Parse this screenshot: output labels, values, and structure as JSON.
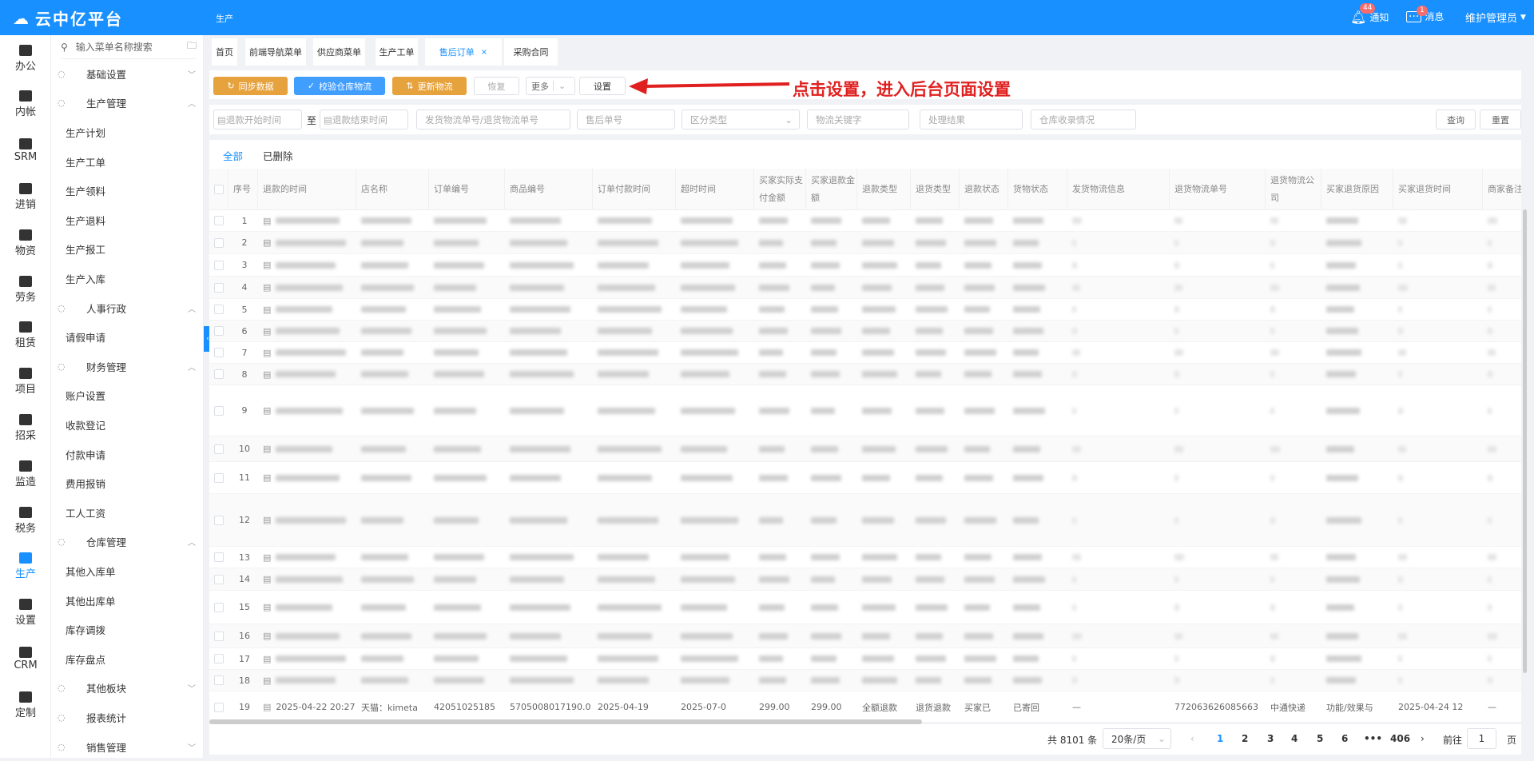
{
  "header": {
    "logo": "云中亿平台",
    "breadcrumb": "生产",
    "notify_label": "通知",
    "notify_count": "44",
    "message_label": "消息",
    "message_count": "1",
    "user": "维护管理员"
  },
  "rail": [
    {
      "label": "办公"
    },
    {
      "label": "内帐"
    },
    {
      "label": "SRM"
    },
    {
      "label": "进销"
    },
    {
      "label": "物资"
    },
    {
      "label": "劳务"
    },
    {
      "label": "租赁"
    },
    {
      "label": "项目"
    },
    {
      "label": "招采"
    },
    {
      "label": "监造"
    },
    {
      "label": "税务"
    },
    {
      "label": "生产",
      "active": true
    },
    {
      "label": "设置"
    },
    {
      "label": "CRM"
    },
    {
      "label": "定制"
    }
  ],
  "sidebar": {
    "search_placeholder": "输入菜单名称搜索",
    "items": [
      {
        "label": "基础设置",
        "type": "group",
        "expanded": false
      },
      {
        "label": "生产管理",
        "type": "group",
        "expanded": true
      },
      {
        "label": "生产计划",
        "type": "sub"
      },
      {
        "label": "生产工单",
        "type": "sub"
      },
      {
        "label": "生产领料",
        "type": "sub"
      },
      {
        "label": "生产退料",
        "type": "sub"
      },
      {
        "label": "生产报工",
        "type": "sub"
      },
      {
        "label": "生产入库",
        "type": "sub"
      },
      {
        "label": "人事行政",
        "type": "group",
        "expanded": true
      },
      {
        "label": "请假申请",
        "type": "sub"
      },
      {
        "label": "财务管理",
        "type": "group",
        "expanded": true
      },
      {
        "label": "账户设置",
        "type": "sub"
      },
      {
        "label": "收款登记",
        "type": "sub"
      },
      {
        "label": "付款申请",
        "type": "sub"
      },
      {
        "label": "费用报销",
        "type": "sub"
      },
      {
        "label": "工人工资",
        "type": "sub"
      },
      {
        "label": "仓库管理",
        "type": "group",
        "expanded": true
      },
      {
        "label": "其他入库单",
        "type": "sub"
      },
      {
        "label": "其他出库单",
        "type": "sub"
      },
      {
        "label": "库存调拨",
        "type": "sub"
      },
      {
        "label": "库存盘点",
        "type": "sub"
      },
      {
        "label": "其他板块",
        "type": "group",
        "expanded": false
      },
      {
        "label": "报表统计",
        "type": "group"
      },
      {
        "label": "销售管理",
        "type": "group",
        "expanded": false
      }
    ]
  },
  "tabs": [
    {
      "label": "首页"
    },
    {
      "label": "前端导航菜单"
    },
    {
      "label": "供应商菜单"
    },
    {
      "label": "生产工单"
    },
    {
      "label": "售后订单",
      "active": true
    },
    {
      "label": "采购合同"
    }
  ],
  "toolbar": {
    "sync": "同步数据",
    "verify": "校验仓库物流",
    "update": "更新物流",
    "restore": "恢复",
    "more": "更多",
    "settings": "设置"
  },
  "annotation": "点击设置，进入后台页面设置",
  "filters": {
    "start": "退款开始时间",
    "to": "至",
    "end": "退款结束时间",
    "logistics_no": "发货物流单号/退货物流单号",
    "aftersale_no": "售后单号",
    "type": "区分类型",
    "keyword": "物流关键字",
    "result": "处理结果",
    "warehouse": "仓库收录情况",
    "query": "查询",
    "reset": "重置"
  },
  "list_tabs": {
    "all": "全部",
    "deleted": "已删除"
  },
  "columns": [
    "",
    "序号",
    "退款的时间",
    "店名称",
    "订单编号",
    "商品编号",
    "订单付款时间",
    "超时时间",
    "买家实际支付金额",
    "买家退款金额",
    "退款类型",
    "退货类型",
    "退款状态",
    "货物状态",
    "发货物流信息",
    "退货物流单号",
    "退货物流公司",
    "买家退货原因",
    "买家退货时间",
    "商家备注"
  ],
  "rows": [
    {
      "index": "1"
    },
    {
      "index": "2"
    },
    {
      "index": "3"
    },
    {
      "index": "4"
    },
    {
      "index": "5"
    },
    {
      "index": "6"
    },
    {
      "index": "7"
    },
    {
      "index": "8"
    },
    {
      "index": "9"
    },
    {
      "index": "10"
    },
    {
      "index": "11"
    },
    {
      "index": "12"
    },
    {
      "index": "13"
    },
    {
      "index": "14"
    },
    {
      "index": "15"
    },
    {
      "index": "16"
    },
    {
      "index": "17"
    },
    {
      "index": "18"
    },
    {
      "index": "19",
      "cells": [
        "2025-04-22 20:27",
        "天猫：kimeta",
        "42051025185",
        "5705008017190.0",
        "2025-04-19",
        "2025-07-0",
        "299.00",
        "299.00",
        "全额退款",
        "退货退款",
        "买家已",
        "已寄回",
        "—",
        "772063626085663",
        "中通快递",
        "功能/效果与",
        "2025-04-24 12",
        "—"
      ]
    }
  ],
  "pagination": {
    "total": "共 8101 条",
    "page_size": "20条/页",
    "pages": [
      "1",
      "2",
      "3",
      "4",
      "5",
      "6",
      "•••",
      "406"
    ],
    "current": "1",
    "goto_label": "前往",
    "goto_value": "1",
    "page_suffix": "页"
  }
}
